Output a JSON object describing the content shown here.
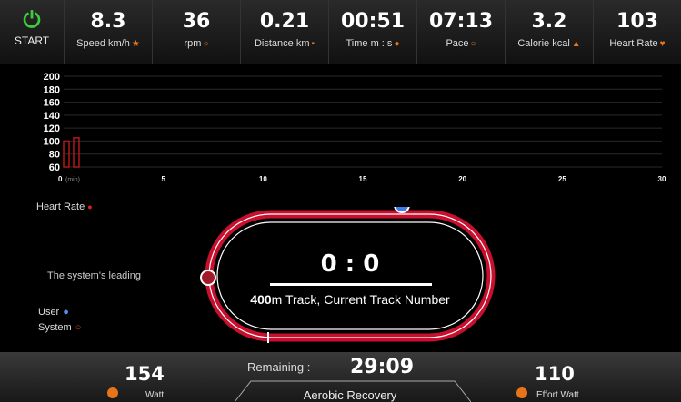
{
  "start": {
    "label": "START",
    "icon": "power-icon"
  },
  "stats": [
    {
      "value": "8.3",
      "unit": "Speed km/h",
      "icon": "runner-icon"
    },
    {
      "value": "36",
      "unit": "rpm",
      "icon": "rpm-icon"
    },
    {
      "value": "0.21",
      "unit": "Distance km",
      "icon": "distance-icon"
    },
    {
      "value": "00:51",
      "unit": "Time m : s",
      "icon": "clock-icon"
    },
    {
      "value": "07:13",
      "unit": "Pace",
      "icon": "pace-icon"
    },
    {
      "value": "3.2",
      "unit": "Calorie kcal",
      "icon": "flame-icon"
    },
    {
      "value": "103",
      "unit": "Heart Rate",
      "icon": "heart-icon"
    }
  ],
  "chart_data": {
    "type": "bar",
    "y_ticks": [
      "200",
      "180",
      "160",
      "140",
      "120",
      "100",
      "80",
      "60"
    ],
    "x_ticks": [
      "0",
      "5",
      "10",
      "15",
      "20",
      "25",
      "30"
    ],
    "x_unit": "(min)",
    "ylim": [
      60,
      200
    ],
    "xlim": [
      0,
      30
    ],
    "series": [
      {
        "name": "Heart Rate",
        "x": [
          0,
          0.5
        ],
        "values": [
          100,
          105
        ]
      }
    ],
    "legend": "Heart Rate",
    "colors": {
      "bar": "#b01818",
      "grid": "#2a2a2a"
    }
  },
  "track": {
    "score": "0 : 0",
    "info_bold": "400",
    "info_rest": "m Track, Current Track Number",
    "leading_text": "The system's leading",
    "legend_user": "User",
    "legend_system": "System",
    "colors": {
      "track": "#c8102e",
      "user": "#3b7dea",
      "system": "#a11a2a"
    }
  },
  "bottom": {
    "watt_value": "154",
    "watt_label": "Watt",
    "remaining_label": "Remaining :",
    "remaining_time": "29:09",
    "mode": "Aerobic Recovery",
    "effort_value": "110",
    "effort_label": "Effort Watt"
  }
}
